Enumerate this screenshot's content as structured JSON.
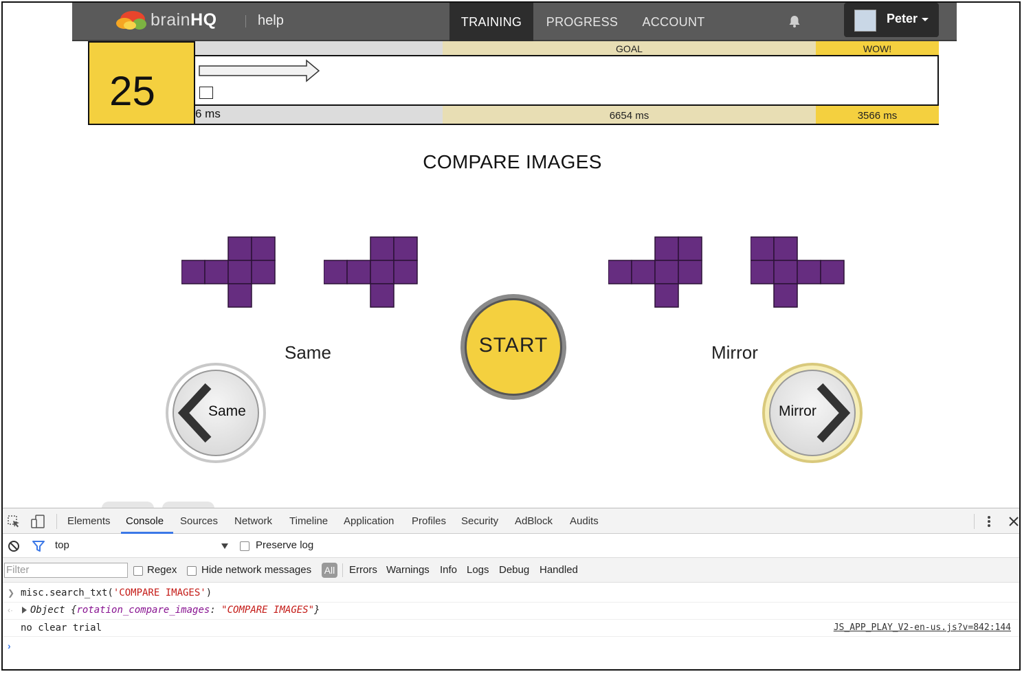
{
  "nav": {
    "logo_light": "brain",
    "logo_bold": "HQ",
    "help": "help",
    "tabs": [
      "TRAINING",
      "PROGRESS",
      "ACCOUNT"
    ],
    "username": "Peter"
  },
  "score": "25",
  "meter": {
    "top_labels": [
      "GOAL",
      "WOW!"
    ],
    "bottom_left": "6 ms",
    "bottom_goal": "6654 ms",
    "bottom_wow": "3566 ms"
  },
  "game": {
    "title": "COMPARE IMAGES",
    "label_same": "Same",
    "label_mirror": "Mirror",
    "start": "START",
    "btn_same": "Same",
    "btn_mirror": "Mirror",
    "shape_color": "#662d80"
  },
  "devtools": {
    "tabs": [
      "Elements",
      "Console",
      "Sources",
      "Network",
      "Timeline",
      "Application",
      "Profiles",
      "Security",
      "AdBlock",
      "Audits"
    ],
    "context": "top",
    "preserve_log": "Preserve log",
    "filter_placeholder": "Filter",
    "regex": "Regex",
    "hide_network": "Hide network messages",
    "all": "All",
    "levels": [
      "Errors",
      "Warnings",
      "Info",
      "Logs",
      "Debug",
      "Handled"
    ],
    "console": {
      "cmd_prefix": "misc.search_txt(",
      "cmd_arg": "'COMPARE IMAGES'",
      "cmd_suffix": ")",
      "obj_prefix": "Object {",
      "obj_key": "rotation_compare_images",
      "obj_sep": ": ",
      "obj_val": "\"COMPARE IMAGES\"",
      "obj_suffix": "}",
      "log": "no clear trial",
      "source": "JS_APP_PLAY_V2-en-us.js?v=842:144"
    }
  }
}
